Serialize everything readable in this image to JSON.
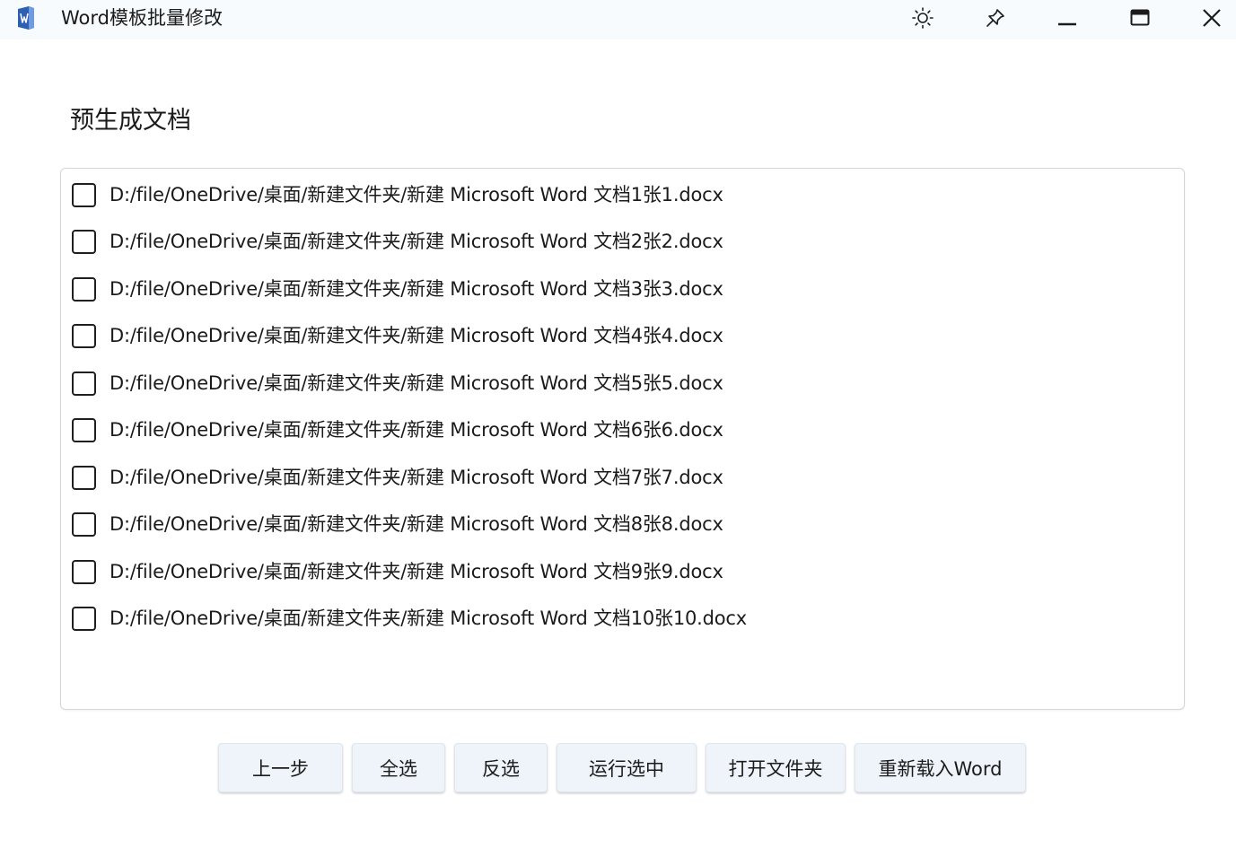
{
  "window": {
    "title": "Word模板批量修改",
    "icons": {
      "app": "word-app-icon",
      "theme": "sun-icon",
      "pin": "pin-icon",
      "minimize": "minimize-icon",
      "maximize": "maximize-icon",
      "close": "close-icon"
    }
  },
  "main": {
    "section_title": "预生成文档",
    "items": [
      {
        "label": "D:/file/OneDrive/桌面/新建文件夹/新建 Microsoft Word 文档1张1.docx",
        "checked": false
      },
      {
        "label": "D:/file/OneDrive/桌面/新建文件夹/新建 Microsoft Word 文档2张2.docx",
        "checked": false
      },
      {
        "label": "D:/file/OneDrive/桌面/新建文件夹/新建 Microsoft Word 文档3张3.docx",
        "checked": false
      },
      {
        "label": "D:/file/OneDrive/桌面/新建文件夹/新建 Microsoft Word 文档4张4.docx",
        "checked": false
      },
      {
        "label": "D:/file/OneDrive/桌面/新建文件夹/新建 Microsoft Word 文档5张5.docx",
        "checked": false
      },
      {
        "label": "D:/file/OneDrive/桌面/新建文件夹/新建 Microsoft Word 文档6张6.docx",
        "checked": false
      },
      {
        "label": "D:/file/OneDrive/桌面/新建文件夹/新建 Microsoft Word 文档7张7.docx",
        "checked": false
      },
      {
        "label": "D:/file/OneDrive/桌面/新建文件夹/新建 Microsoft Word 文档8张8.docx",
        "checked": false
      },
      {
        "label": "D:/file/OneDrive/桌面/新建文件夹/新建 Microsoft Word 文档9张9.docx",
        "checked": false
      },
      {
        "label": "D:/file/OneDrive/桌面/新建文件夹/新建 Microsoft Word 文档10张10.docx",
        "checked": false
      }
    ]
  },
  "actions": {
    "prev": "上一步",
    "select_all": "全选",
    "invert": "反选",
    "run_selected": "运行选中",
    "open_folder": "打开文件夹",
    "reload_word": "重新载入Word"
  }
}
